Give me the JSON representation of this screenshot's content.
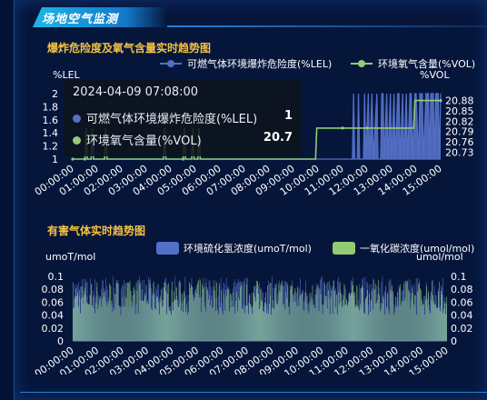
{
  "header": {
    "title": "场地空气监测"
  },
  "colors": {
    "blue": "#5470c6",
    "green": "#91cc75",
    "title": "#f5c242",
    "axis": "#ffffff"
  },
  "chart_data": [
    {
      "type": "line",
      "title": "爆炸危险度及氧气含量实时趋势图",
      "left_axis_label": "%LEL",
      "right_axis_label": "%VOL",
      "x_ticks": [
        "00:00:00",
        "01:00:00",
        "02:00:00",
        "03:00:00",
        "04:00:00",
        "05:00:00",
        "06:00:00",
        "07:00:00",
        "08:00:00",
        "09:00:00",
        "10:00:00",
        "11:00:00",
        "12:00:00",
        "13:00:00",
        "14:00:00",
        "15:00:00"
      ],
      "left_ticks": [
        "1",
        "1.2",
        "1.4",
        "1.6",
        "1.8",
        "2"
      ],
      "right_ticks": [
        "20.73",
        "20.76",
        "20.79",
        "20.82",
        "20.85",
        "20.88"
      ],
      "ylim_left": [
        1,
        2
      ],
      "ylim_right": [
        20.71,
        20.9
      ],
      "series": [
        {
          "name": "可燃气体环境爆炸危险度(%LEL)",
          "axis": "left",
          "color": "#5470c6",
          "points": [
            [
              0,
              1
            ],
            [
              11.4,
              1
            ],
            [
              11.45,
              2
            ],
            [
              11.5,
              1
            ],
            [
              11.6,
              1
            ],
            [
              11.65,
              2
            ],
            [
              11.7,
              1
            ],
            [
              11.85,
              1
            ],
            [
              11.9,
              2
            ],
            [
              11.95,
              1
            ],
            [
              12.05,
              2
            ],
            [
              12.1,
              1
            ],
            [
              12.2,
              2
            ],
            [
              12.25,
              1
            ],
            [
              12.4,
              2
            ],
            [
              12.45,
              1
            ],
            [
              12.55,
              1
            ],
            [
              12.6,
              2
            ],
            [
              12.65,
              2
            ],
            [
              12.7,
              1
            ],
            [
              12.8,
              2
            ],
            [
              12.85,
              1
            ],
            [
              12.95,
              2
            ],
            [
              13.0,
              1
            ],
            [
              13.1,
              2
            ],
            [
              13.15,
              1
            ],
            [
              13.25,
              2
            ],
            [
              13.3,
              2
            ],
            [
              13.35,
              1
            ],
            [
              13.45,
              2
            ],
            [
              13.5,
              1
            ],
            [
              13.6,
              2
            ],
            [
              13.65,
              1
            ],
            [
              13.75,
              2
            ],
            [
              13.8,
              2
            ],
            [
              13.85,
              1
            ],
            [
              13.95,
              2
            ],
            [
              14.0,
              2
            ],
            [
              14.1,
              1
            ],
            [
              14.15,
              2
            ],
            [
              14.25,
              2
            ],
            [
              14.3,
              1
            ],
            [
              14.4,
              2
            ],
            [
              14.5,
              2
            ],
            [
              14.55,
              1
            ],
            [
              14.6,
              2
            ],
            [
              14.7,
              2
            ],
            [
              14.75,
              1
            ],
            [
              14.8,
              2
            ],
            [
              14.9,
              2
            ],
            [
              14.95,
              1
            ],
            [
              15.0,
              2
            ]
          ]
        },
        {
          "name": "环境氧气含量(%VOL)",
          "axis": "right",
          "color": "#91cc75",
          "points": [
            [
              0,
              20.71
            ],
            [
              0.5,
              20.71
            ],
            [
              0.55,
              20.8
            ],
            [
              0.6,
              20.71
            ],
            [
              0.75,
              20.71
            ],
            [
              0.8,
              20.8
            ],
            [
              0.85,
              20.71
            ],
            [
              1.3,
              20.71
            ],
            [
              1.35,
              20.8
            ],
            [
              1.4,
              20.71
            ],
            [
              3.7,
              20.71
            ],
            [
              3.75,
              20.8
            ],
            [
              3.8,
              20.71
            ],
            [
              4.5,
              20.71
            ],
            [
              4.55,
              20.8
            ],
            [
              4.6,
              20.71
            ],
            [
              4.85,
              20.71
            ],
            [
              4.9,
              20.8
            ],
            [
              4.95,
              20.71
            ],
            [
              5.1,
              20.71
            ],
            [
              5.15,
              20.8
            ],
            [
              5.2,
              20.71
            ],
            [
              9.9,
              20.71
            ],
            [
              9.95,
              20.8
            ],
            [
              11.0,
              20.8
            ],
            [
              12.0,
              20.8
            ],
            [
              13.9,
              20.8
            ],
            [
              13.95,
              20.88
            ],
            [
              15.0,
              20.88
            ]
          ]
        }
      ],
      "tooltip": {
        "time": "2024-04-09 07:08:00",
        "values": [
          "1",
          "20.7"
        ]
      }
    },
    {
      "type": "bar",
      "title": "有害气体实时趋势图",
      "left_axis_label": "umoT/mol",
      "right_axis_label": "umol/mol",
      "x_ticks": [
        "00:00:00",
        "01:00:00",
        "02:00:00",
        "03:00:00",
        "04:00:00",
        "05:00:00",
        "06:00:00",
        "07:00:00",
        "08:00:00",
        "09:00:00",
        "10:00:00",
        "11:00:00",
        "12:00:00",
        "13:00:00",
        "14:00:00",
        "15:00:00"
      ],
      "left_ticks": [
        "0",
        "0.02",
        "0.04",
        "0.06",
        "0.08",
        "0.1"
      ],
      "right_ticks": [
        "0",
        "0.02",
        "0.04",
        "0.06",
        "0.08",
        "0.1"
      ],
      "ylim": [
        0,
        0.1
      ],
      "series": [
        {
          "name": "环境硫化氢浓度(umoT/mol)",
          "color": "#5470c6",
          "typical_range": [
            0.05,
            0.1
          ]
        },
        {
          "name": "一氧化碳浓度(umol/mol)",
          "color": "#91cc75",
          "typical_range": [
            0.04,
            0.095
          ]
        }
      ]
    }
  ]
}
